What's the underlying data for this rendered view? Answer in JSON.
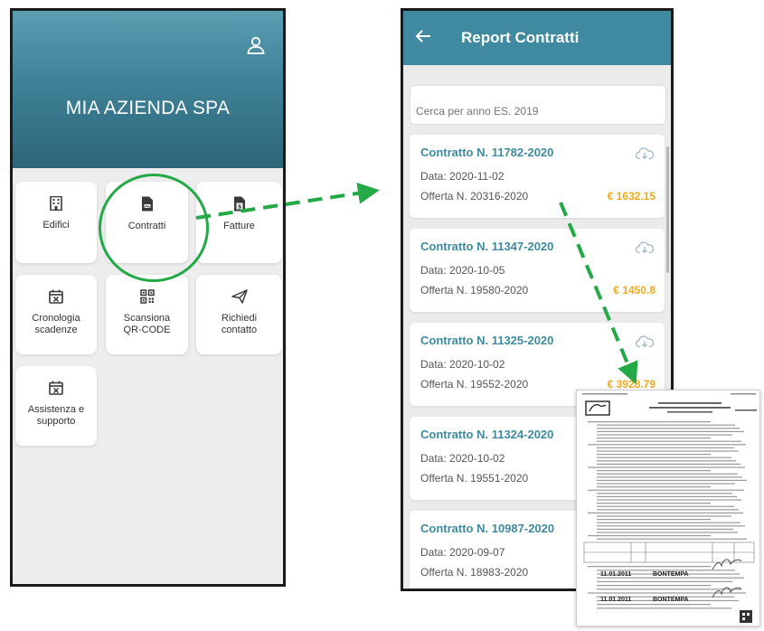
{
  "home": {
    "company_name": "MIA AZIENDA SPA",
    "tiles": [
      {
        "label": "Edifici"
      },
      {
        "label": "Contratti"
      },
      {
        "label": "Fatture"
      },
      {
        "label": "Cronologia\nscadenze"
      },
      {
        "label": "Scansiona\nQR-CODE"
      },
      {
        "label": "Richiedi\ncontatto"
      },
      {
        "label": "Assistenza e\nsupporto"
      }
    ]
  },
  "report": {
    "title": "Report Contratti",
    "search_placeholder": "Cerca per anno ES. 2019",
    "contracts": [
      {
        "title": "Contratto N. 11782-2020",
        "date": "Data: 2020-11-02",
        "offer": "Offerta N. 20316-2020",
        "amount": "€ 1632.15"
      },
      {
        "title": "Contratto N. 11347-2020",
        "date": "Data: 2020-10-05",
        "offer": "Offerta N. 19580-2020",
        "amount": "€ 1450.8"
      },
      {
        "title": "Contratto N. 11325-2020",
        "date": "Data: 2020-10-02",
        "offer": "Offerta N. 19552-2020",
        "amount": "€ 3928.79"
      },
      {
        "title": "Contratto N. 11324-2020",
        "date": "Data: 2020-10-02",
        "offer": "Offerta N. 19551-2020",
        "amount": ""
      },
      {
        "title": "Contratto N. 10987-2020",
        "date": "Data: 2020-09-07",
        "offer": "Offerta N. 18983-2020",
        "amount": ""
      }
    ]
  },
  "document": {
    "date_1": "11.01.2011",
    "date_2": "11.01.2011",
    "signature_1": "BONTEMPA",
    "signature_2": "BONTEMPA"
  },
  "colors": {
    "header_teal": "#3f8aa0",
    "accent_green": "#23a946",
    "amount_orange": "#f0a917"
  },
  "icons": [
    "user-icon",
    "building-icon",
    "contract-file-icon",
    "invoice-file-icon",
    "calendar-x-icon",
    "qr-code-icon",
    "send-icon",
    "back-arrow-icon",
    "cloud-download-icon"
  ]
}
